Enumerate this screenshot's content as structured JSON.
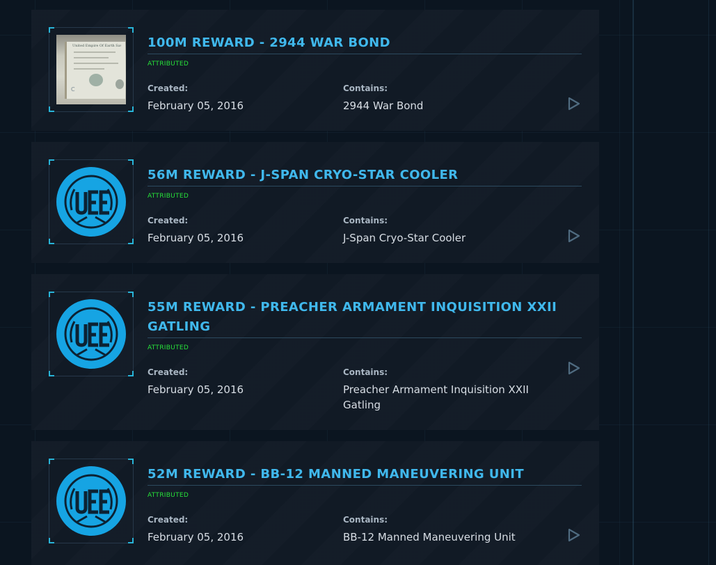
{
  "colors": {
    "title": "#40b8ec",
    "status": "#27e23a",
    "card_bg": "#111a25",
    "frame_accent": "#28b4d8",
    "logo_blue": "#16a4e3"
  },
  "labels": {
    "created": "Created:",
    "contains": "Contains:"
  },
  "items": [
    {
      "title": "100M REWARD - 2944 WAR BOND",
      "status": "ATTRIBUTED",
      "created": "February 05, 2016",
      "contains": "2944 War Bond",
      "thumbnail_icon": "war-bond-certificate-image",
      "bond_heading": "United Empire Of Earth Savings Bond",
      "bond_mark": "C"
    },
    {
      "title": "56M REWARD - J-SPAN CRYO-STAR COOLER",
      "status": "ATTRIBUTED",
      "created": "February 05, 2016",
      "contains": "J-Span Cryo-Star Cooler",
      "thumbnail_icon": "uee-logo"
    },
    {
      "title": "55M REWARD - PREACHER ARMAMENT INQUISITION XXII GATLING",
      "status": "ATTRIBUTED",
      "created": "February 05, 2016",
      "contains": "Preacher Armament Inquisition XXII Gatling",
      "thumbnail_icon": "uee-logo"
    },
    {
      "title": "52M REWARD - BB-12 MANNED MANEUVERING UNIT",
      "status": "ATTRIBUTED",
      "created": "February 05, 2016",
      "contains": "BB-12 Manned Maneuvering Unit",
      "thumbnail_icon": "uee-logo"
    }
  ]
}
